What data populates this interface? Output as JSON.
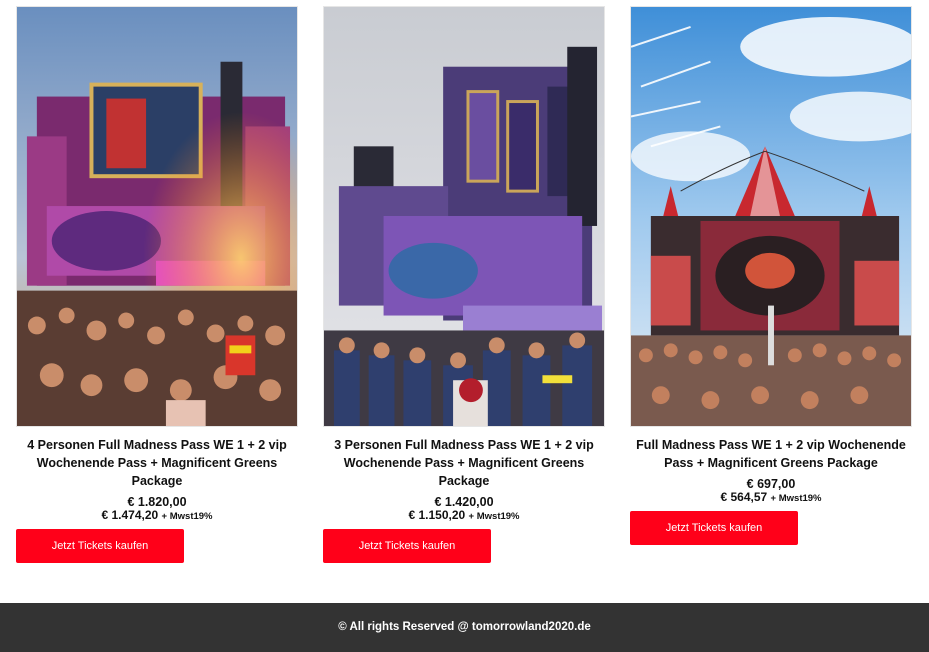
{
  "products": [
    {
      "title": "4 Personen Full Madness Pass WE 1 + 2 vip Wochenende Pass + Magnificent Greens Package",
      "price": "€ 1.820,00",
      "price_net": "€ 1.474,20",
      "tax_note": "+ Mwst19%",
      "button_label": "Jetzt Tickets kaufen"
    },
    {
      "title": "3 Personen Full Madness Pass WE 1 + 2 vip Wochenende Pass + Magnificent Greens Package",
      "price": "€ 1.420,00",
      "price_net": "€ 1.150,20",
      "tax_note": "+ Mwst19%",
      "button_label": "Jetzt Tickets kaufen"
    },
    {
      "title": "Full Madness Pass WE 1 + 2 vip Wochenende Pass + Magnificent Greens Package",
      "price": "€ 697,00",
      "price_net": "€ 564,57",
      "tax_note": "+ Mwst19%",
      "button_label": "Jetzt Tickets kaufen"
    }
  ],
  "footer": {
    "text": "© All rights Reserved @ tomorrowland2020.de"
  },
  "colors": {
    "button": "#ff0019",
    "footer_bg": "#333333"
  }
}
